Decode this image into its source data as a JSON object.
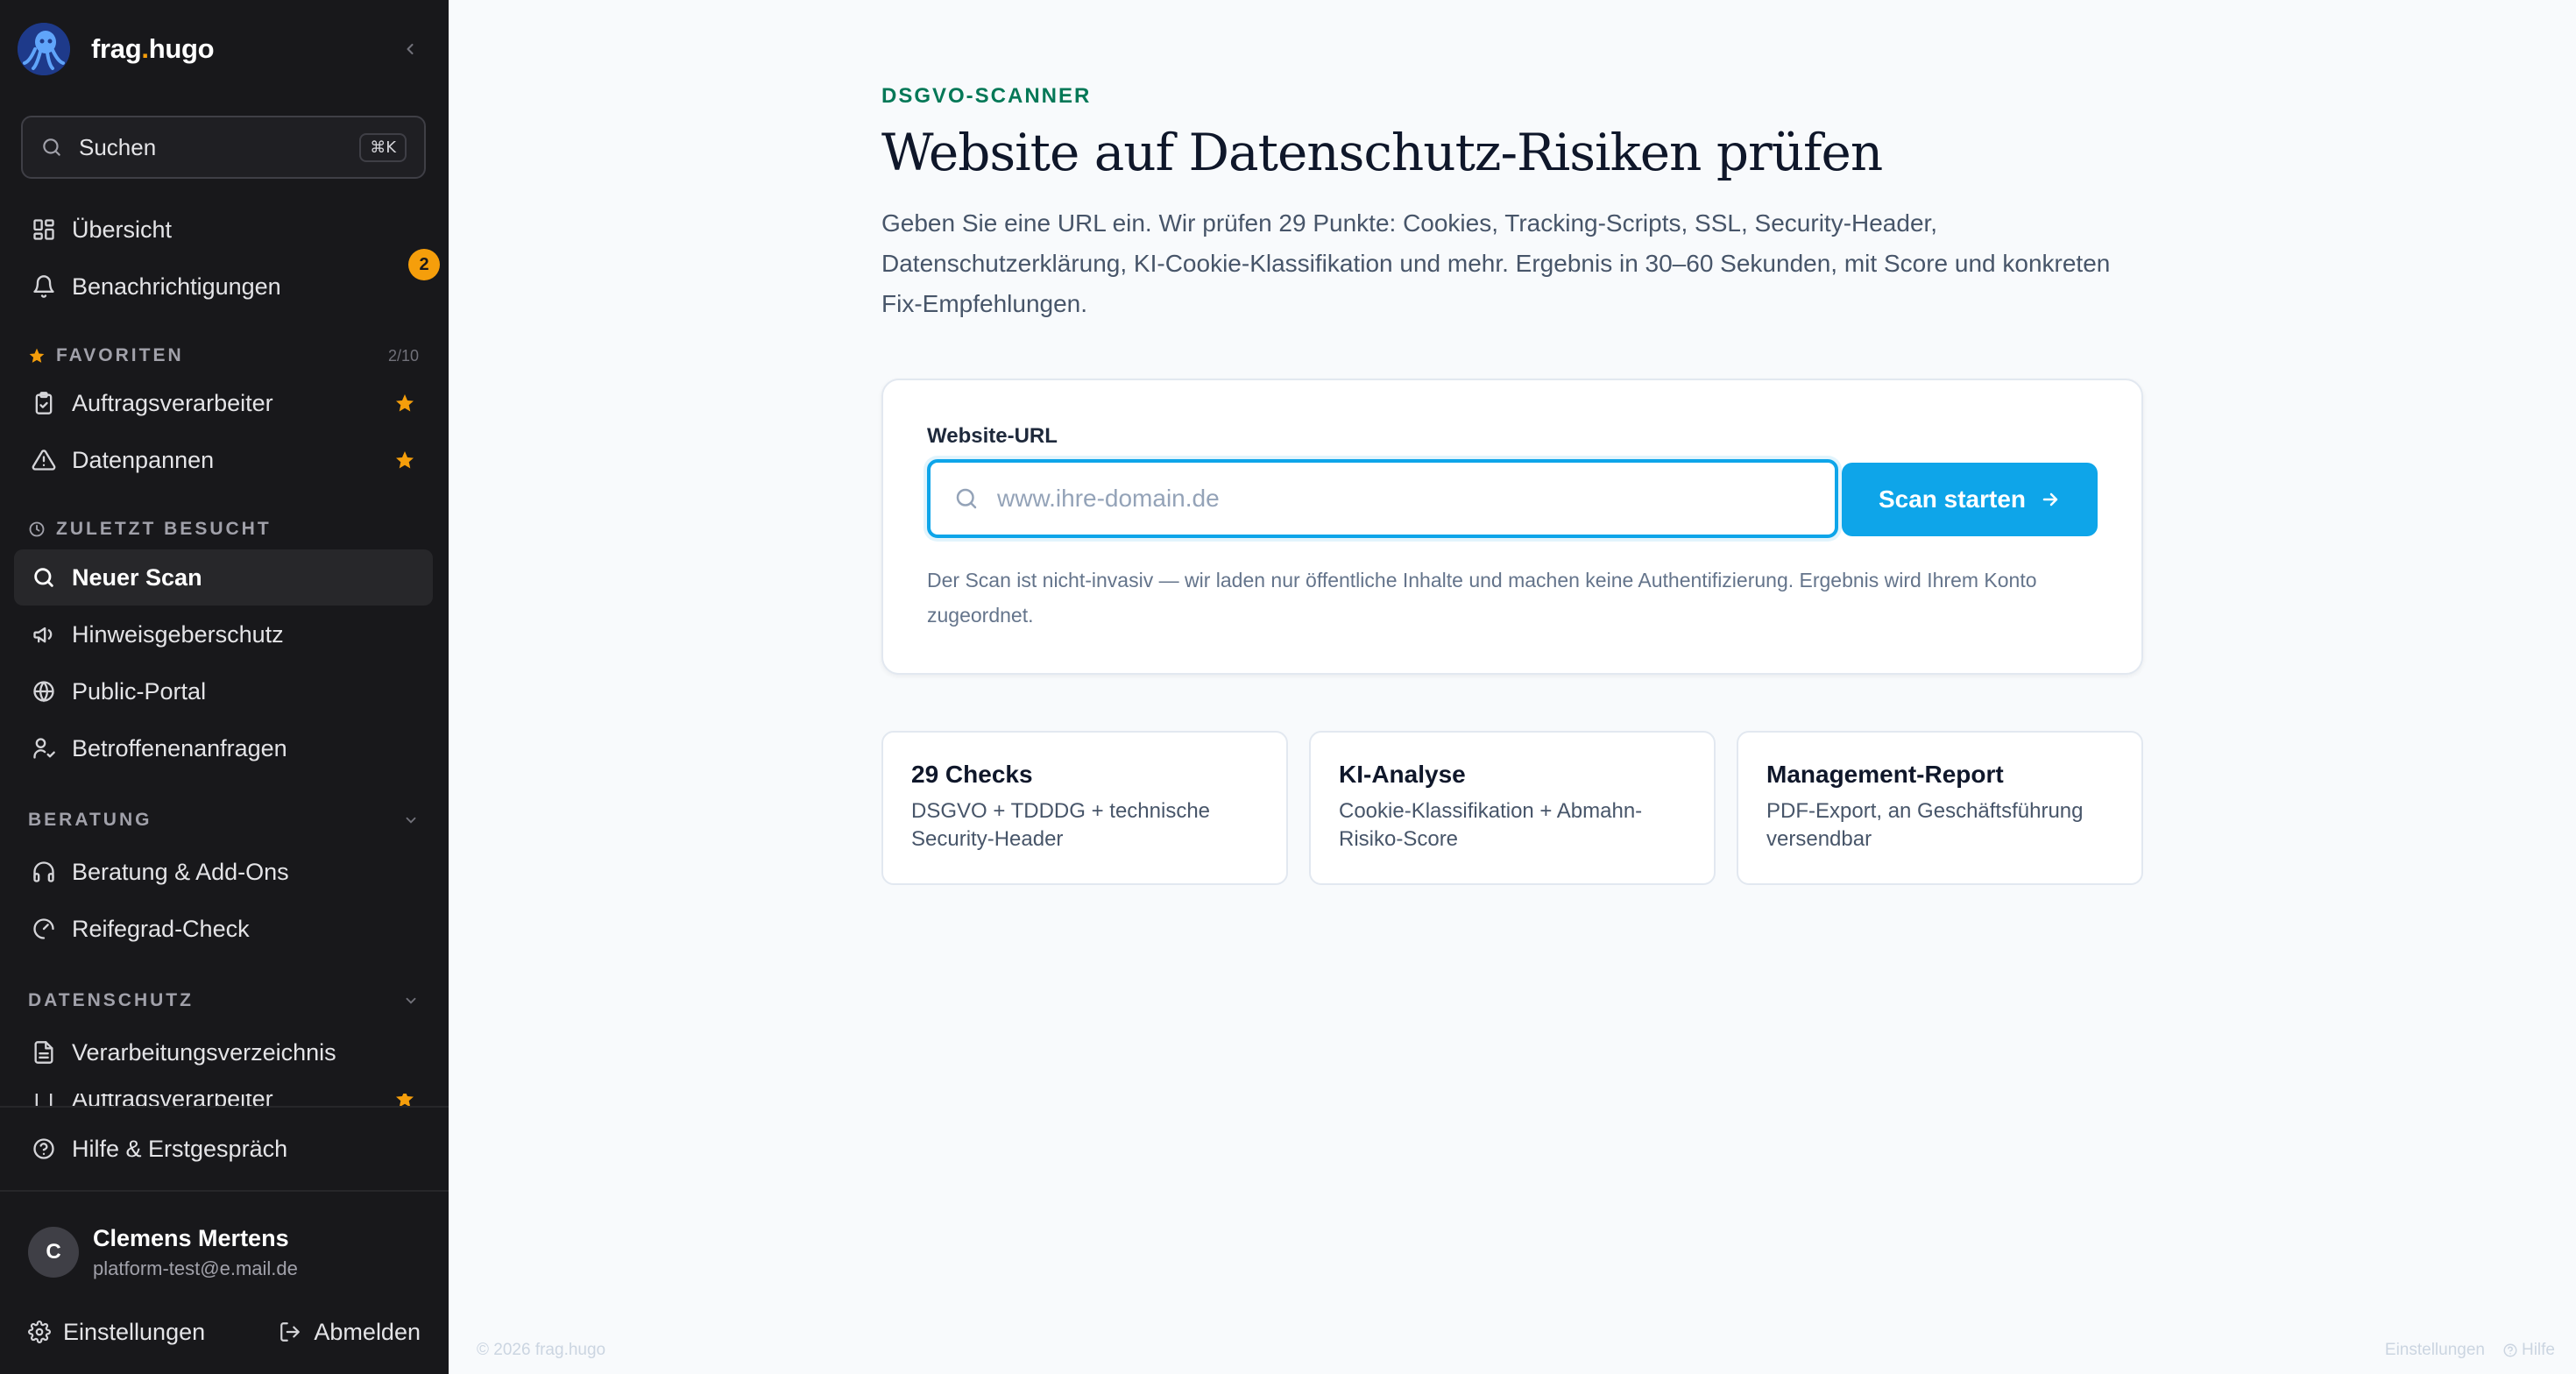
{
  "brand": {
    "name_prefix": "frag",
    "name_dot": ".",
    "name_suffix": "hugo"
  },
  "search": {
    "label": "Suchen",
    "shortcut": "⌘K"
  },
  "nav": {
    "overview": "Übersicht",
    "notifications": "Benachrichtigungen",
    "notifications_count": "2"
  },
  "favorites": {
    "heading": "FAVORITEN",
    "count": "2/10",
    "items": [
      "Auftragsverarbeiter",
      "Datenpannen"
    ]
  },
  "recent": {
    "heading": "ZULETZT BESUCHT",
    "items": [
      "Neuer Scan",
      "Hinweisgeberschutz",
      "Public-Portal",
      "Betroffenenanfragen"
    ]
  },
  "beratung": {
    "heading": "BERATUNG",
    "items": [
      "Beratung & Add-Ons",
      "Reifegrad-Check"
    ]
  },
  "datenschutz": {
    "heading": "DATENSCHUTZ",
    "items": [
      "Verarbeitungsverzeichnis",
      "Auftragsverarbeiter"
    ]
  },
  "help": "Hilfe & Erstgespräch",
  "user": {
    "initial": "C",
    "name": "Clemens Mertens",
    "email": "platform-test@e.mail.de"
  },
  "footer": {
    "settings": "Einstellungen",
    "logout": "Abmelden"
  },
  "main": {
    "eyebrow": "DSGVO-SCANNER",
    "title": "Website auf Datenschutz-Risiken prüfen",
    "description": "Geben Sie eine URL ein. Wir prüfen 29 Punkte: Cookies, Tracking-Scripts, SSL, Security-Header, Datenschutzerklärung, KI-Cookie-Klassifikation und mehr. Ergebnis in 30–60 Sekunden, mit Score und konkreten Fix-Empfehlungen.",
    "field_label": "Website-URL",
    "url_value": "",
    "url_placeholder": "www.ihre-domain.de",
    "scan_button": "Scan starten",
    "hint": "Der Scan ist nicht-invasiv — wir laden nur öffentliche Inhalte und machen keine Authentifizierung. Ergebnis wird Ihrem Konto zugeordnet.",
    "features": [
      {
        "title": "29 Checks",
        "text": "DSGVO + TDDDG + technische Security-Header"
      },
      {
        "title": "KI-Analyse",
        "text": "Cookie-Klassifikation + Abmahn-Risiko-Score"
      },
      {
        "title": "Management-Report",
        "text": "PDF-Export, an Geschäftsführung versendbar"
      }
    ]
  },
  "page_footer": {
    "copyright": "© 2026 frag.hugo",
    "settings": "Einstellungen",
    "help": "Hilfe"
  },
  "colors": {
    "accent": "#0ea5e9",
    "eyebrow": "#047857",
    "badge": "#f59e0b",
    "sidebar": "#18181b"
  }
}
